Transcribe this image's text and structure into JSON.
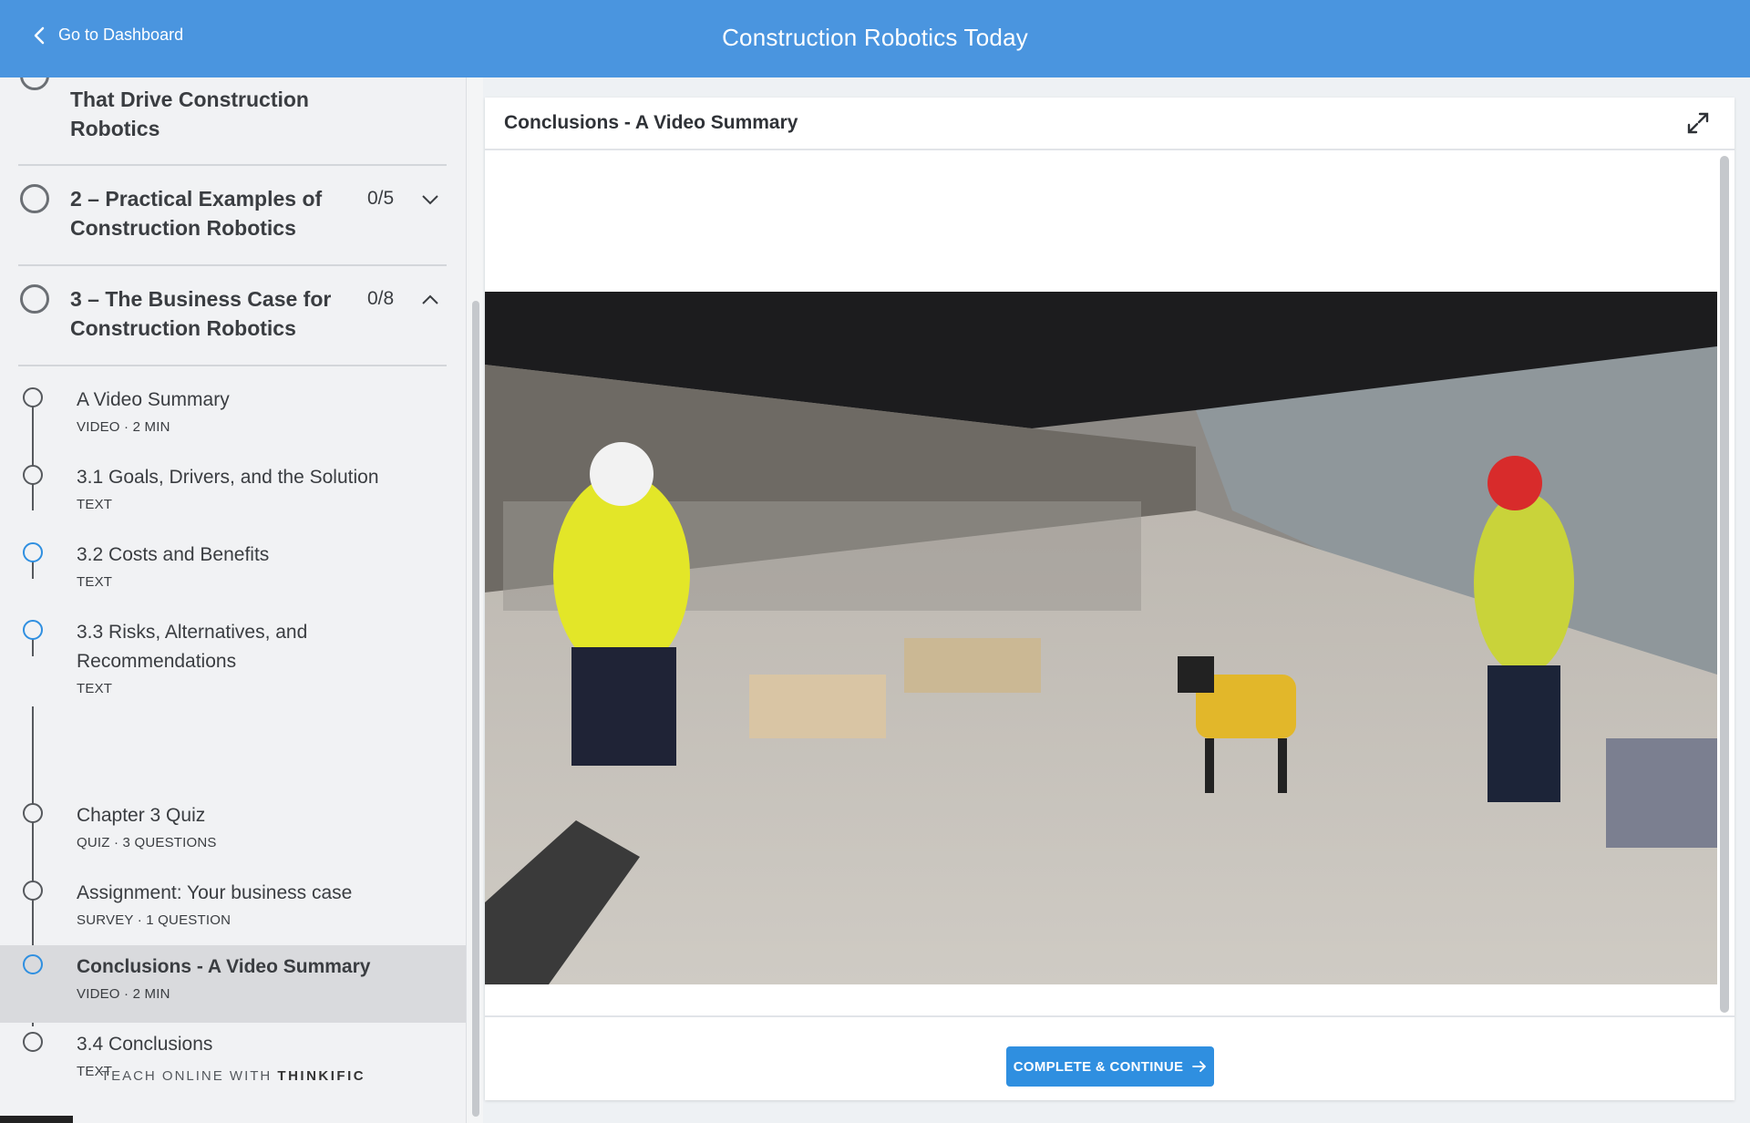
{
  "header": {
    "back_label": "Go to Dashboard",
    "course_title": "Construction Robotics Today",
    "bg_color": "#4a95df"
  },
  "sidebar": {
    "chapters": [
      {
        "title": "That Drive Construction Robotics",
        "count": ""
      },
      {
        "title": "2 – Practical Examples of Construction Robotics",
        "count": "0/5",
        "expanded": false
      },
      {
        "title": "3 – The Business Case for Construction Robotics",
        "count": "0/8",
        "expanded": true
      }
    ],
    "lessons": [
      {
        "title": "A Video Summary",
        "meta": "VIDEO · 2 MIN"
      },
      {
        "title": "3.1 Goals, Drivers, and the Solution",
        "meta": "TEXT"
      },
      {
        "title": "3.2 Costs and Benefits",
        "meta": "TEXT"
      },
      {
        "title": "3.3 Risks, Alternatives, and Recommendations",
        "meta": "TEXT"
      },
      {
        "title": "Chapter 3 Quiz",
        "meta": "QUIZ · 3 QUESTIONS"
      },
      {
        "title": "Assignment: Your business case",
        "meta": "SURVEY · 1 QUESTION"
      },
      {
        "title": "Conclusions - A Video Summary",
        "meta": "VIDEO · 2 MIN",
        "active": true
      },
      {
        "title": "3.4 Conclusions",
        "meta": "TEXT"
      }
    ],
    "footer_prefix": "TEACH ONLINE WITH",
    "footer_brand": "THINKIFIC"
  },
  "content": {
    "lesson_title": "Conclusions - A Video Summary",
    "complete_button": "COMPLETE & CONTINUE",
    "accent_color": "#2f8fe0"
  }
}
